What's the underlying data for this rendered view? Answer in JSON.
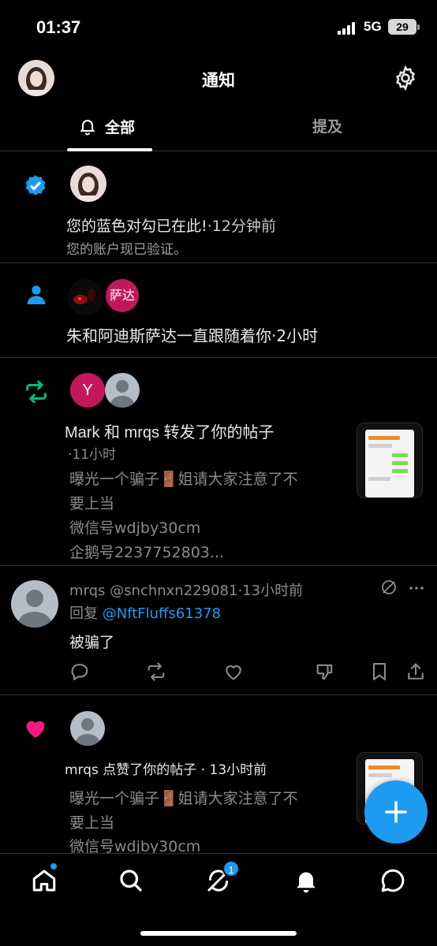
{
  "status_bar": {
    "time": "01:37",
    "network": "5G",
    "battery": "29"
  },
  "header": {
    "title": "通知",
    "settings_icon": "gear-icon"
  },
  "tabs": [
    {
      "label": "全部",
      "icon": "bell-icon",
      "active": true
    },
    {
      "label": "提及",
      "active": false
    }
  ],
  "notifications": {
    "verified": {
      "icon": "verified-badge-icon",
      "title": "您的蓝色对勾已在此!",
      "time": "·12分钟前",
      "body": "您的账户现已验证。"
    },
    "follow": {
      "icon": "person-icon",
      "avatar_label": "萨达",
      "text": "朱和阿迪斯萨达一直跟随着你",
      "time": "·2小时"
    },
    "repost": {
      "icon": "repost-icon",
      "avatar_letter": "Y",
      "text": "Mark 和 mrqs 转发了你的帖子",
      "time": "·11小时",
      "excerpt_line1": "曝光一个骗子🚪姐请大家注意了不",
      "excerpt_line2": "要上当",
      "excerpt_line3": "微信号wdjby30cm",
      "excerpt_line4": "企鹅号2237752803..."
    },
    "reply": {
      "name": "mrqs",
      "handle": "@snchnxn229081",
      "time": "·13小时前",
      "reply_prefix": "回复",
      "reply_to": "@NftFluffs61378",
      "body": "被骗了",
      "actions": [
        "reply-icon",
        "repost-icon",
        "like-icon",
        "dislike-icon",
        "bookmark-icon",
        "share-icon"
      ]
    },
    "like": {
      "icon": "heart-icon",
      "text": "mrqs 点赞了你的帖子",
      "time": "· 13小时前",
      "excerpt_line1": "曝光一个骗子🚪姐请大家注意了不",
      "excerpt_line2": "要上当",
      "excerpt_line3": "微信号wdjby30cm"
    }
  },
  "bottom_nav": {
    "items": [
      "home-icon",
      "search-icon",
      "grok-icon",
      "notifications-icon",
      "messages-icon"
    ],
    "grok_badge": "1"
  },
  "colors": {
    "accent": "#1d9bf0",
    "repost": "#00ba7c",
    "like": "#f91880",
    "avatar_pink": "#c2185b"
  }
}
